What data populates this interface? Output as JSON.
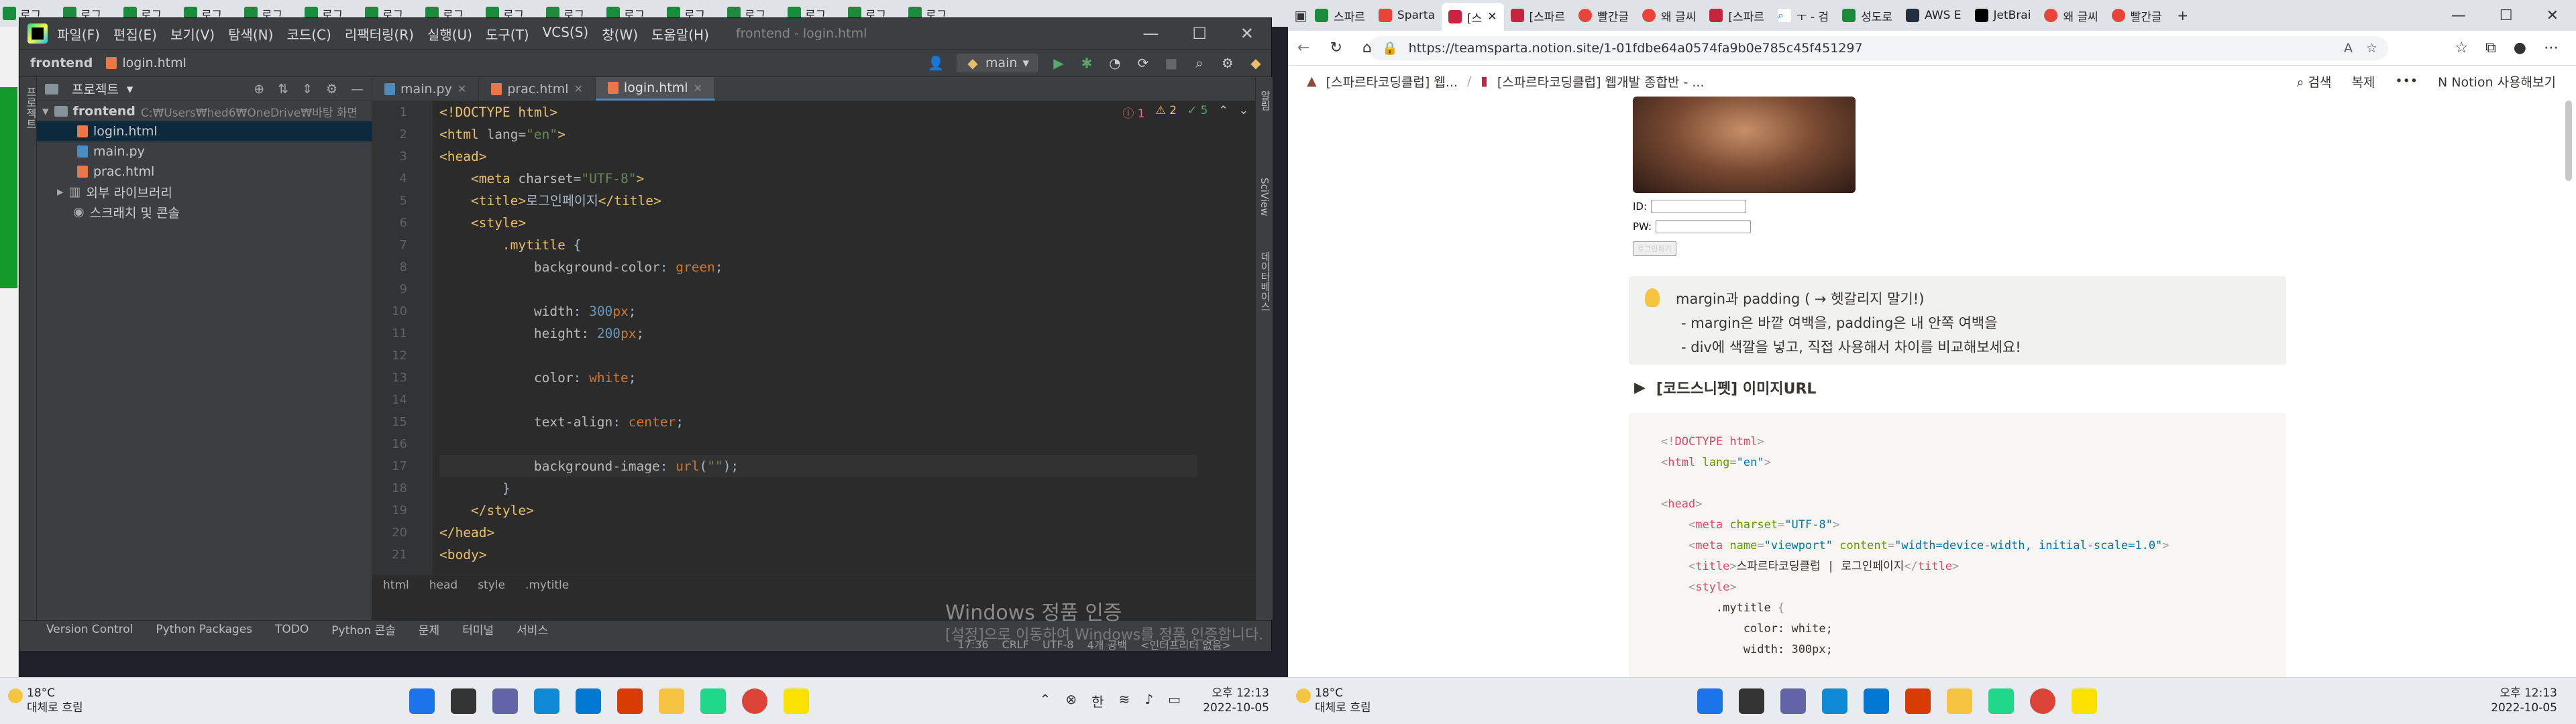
{
  "left_bg": {
    "tabs": [
      "로그",
      "로그",
      "로그",
      "로그",
      "로그",
      "로그",
      "로그",
      "로그",
      "로그",
      "로그",
      "로그",
      "로그",
      "로그",
      "로그",
      "로그",
      "로그"
    ]
  },
  "ide": {
    "menu": [
      "파일(F)",
      "편집(E)",
      "보기(V)",
      "탐색(N)",
      "코드(C)",
      "리팩터링(R)",
      "실행(U)",
      "도구(T)",
      "VCS(S)",
      "창(W)",
      "도움말(H)"
    ],
    "title": "frontend - login.html",
    "nav": {
      "project": "frontend",
      "file": "login.html",
      "branch": "main"
    },
    "project_panel": {
      "title": "프로젝트",
      "root": "frontend",
      "root_path": "C:₩Users₩hed6₩OneDrive₩바탕 화면",
      "files": [
        "login.html",
        "main.py",
        "prac.html"
      ],
      "external": "외부 라이브러리",
      "scratch": "스크래치 및 콘솔",
      "left_strip_label": "프로젝트"
    },
    "tabs": [
      {
        "name": "main.py"
      },
      {
        "name": "prac.html"
      },
      {
        "name": "login.html"
      }
    ],
    "inspection": {
      "errors": "1",
      "warnings": "2",
      "ok": "5"
    },
    "line_numbers": [
      "1",
      "2",
      "3",
      "4",
      "5",
      "6",
      "7",
      "8",
      "9",
      "10",
      "11",
      "12",
      "13",
      "14",
      "15",
      "16",
      "17",
      "18",
      "19",
      "20",
      "21"
    ],
    "breadcrumbs": [
      "html",
      "head",
      "style",
      ".mytitle"
    ],
    "bottom_tools": [
      "Version Control",
      "Python Packages",
      "TODO",
      "Python 콘솔",
      "문제",
      "터미널",
      "서비스"
    ],
    "status": [
      "17:36",
      "CRLF",
      "UTF-8",
      "4개 공백",
      "<인터프리터 없음>"
    ],
    "watermark_title": "Windows 정품 인증",
    "watermark_sub": "[설정]으로 이동하여 Windows를 정품 인증합니다.",
    "right_strip": [
      "알림",
      "SciView",
      "데이터베이스"
    ]
  },
  "taskbar": {
    "temp": "18°C",
    "weather": "대체로 흐림",
    "time": "오후 12:13",
    "date": "2022-10-05",
    "lang": "한"
  },
  "edge": {
    "tabs": [
      "스파르",
      "Sparta",
      "[스",
      "[스파르",
      "빨간글",
      "왜 글씨",
      "[스파르",
      "ㅜ - 검",
      "성도로",
      "AWS E",
      "JetBrai",
      "왜 글씨",
      "빨간글"
    ],
    "url": "https://teamsparta.notion.site/1-01fdbe64a0574fa9b0e785c45f451297",
    "breadcrumb1": "[스파르타코딩클럽] 웹...",
    "breadcrumb2": "[스파르타코딩클럽] 웹개발 종합반 - ...",
    "actions": [
      "검색",
      "복제",
      "Notion 사용해보기"
    ],
    "form": {
      "id_label": "ID:",
      "pw_label": "PW:",
      "button": "로그인하기"
    },
    "callout": {
      "line1": "margin과 padding     ( → 헷갈리지 말기!)",
      "line2": "- margin은 바깥 여백을, padding은 내 안쪽 여백을",
      "line3": "- div에 색깔을 넣고, 직접 사용해서 차이를 비교해보세요!"
    },
    "toggle": "[코드스니펫] 이미지URL"
  }
}
